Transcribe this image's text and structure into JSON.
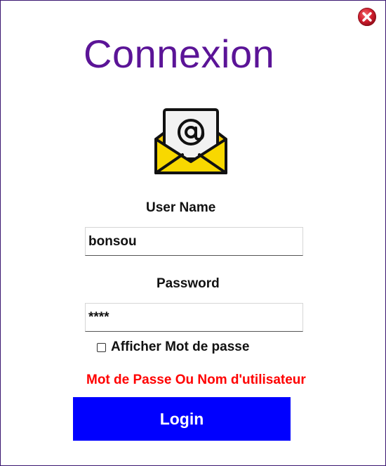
{
  "window": {
    "close_icon": "close-icon",
    "close_color": "#c0182b"
  },
  "title": "Connexion",
  "header_icon": "email-envelope-icon",
  "username": {
    "label": "User Name",
    "value": "bonsou"
  },
  "password": {
    "label": "Password",
    "value": "****"
  },
  "show_password": {
    "label": "Afficher Mot de passe",
    "checked": false
  },
  "error_message": "Mot de Passe Ou Nom d'utilisateur",
  "login_button": {
    "label": "Login"
  },
  "colors": {
    "title": "#5b1497",
    "error": "#ff0000",
    "button": "#0000ff",
    "border": "#3a1670"
  }
}
